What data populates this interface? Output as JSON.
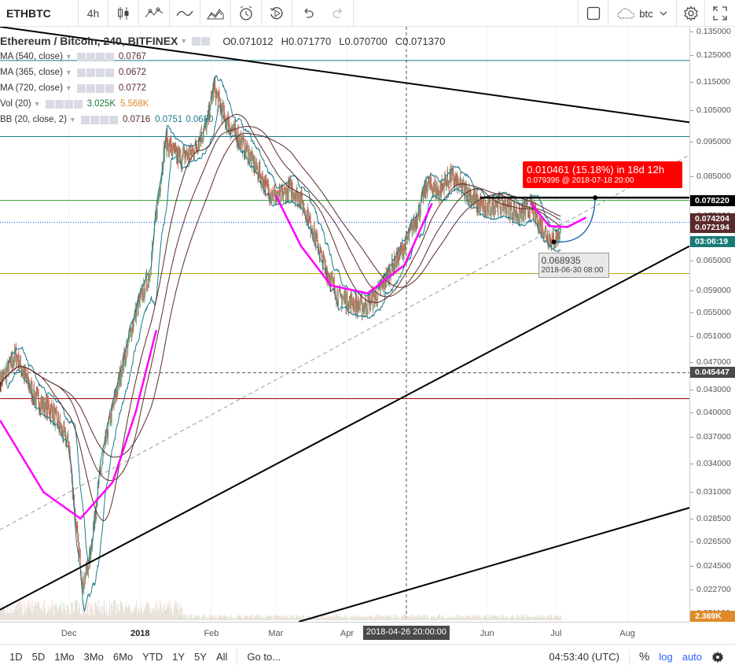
{
  "toolbar": {
    "symbol": "ETHBTC",
    "interval": "4h",
    "compare": "btc",
    "icons": [
      "candles-icon",
      "indicators-icon",
      "line-icon",
      "templates-icon",
      "alert-icon",
      "replay-icon",
      "undo-icon",
      "redo-icon",
      "fullscreen-box-icon",
      "cloud-icon",
      "settings-icon",
      "maximize-icon"
    ]
  },
  "legend": {
    "title": "Ethereum / Bitcoin, 240, BITFINEX",
    "ohlc": {
      "o": "O0.071012",
      "h": "H0.071770",
      "l": "L0.070700",
      "c": "C0.071370"
    },
    "studies": [
      {
        "label": "MA (540, close)",
        "value": "0.0767"
      },
      {
        "label": "MA (365, close)",
        "value": "0.0672"
      },
      {
        "label": "MA (720, close)",
        "value": "0.0772"
      },
      {
        "label": "Vol (20)",
        "value": "3.025K",
        "value2": "5.568K"
      },
      {
        "label": "BB (20, close, 2)",
        "value": "0.0716",
        "value2": "0.0751",
        "value3": "0.0680"
      }
    ]
  },
  "measure": {
    "main": "0.010461 (15.18%) in 18d 12h",
    "sub": "0.079396 @ 2018-07-18  20:00"
  },
  "low_label": {
    "price": "0.068935",
    "time": "2018-06-30 08:00"
  },
  "price_tags": {
    "level": "0.078220",
    "ma_a": "0.074204",
    "ma_b": "0.072194",
    "countdown": "03:06:19",
    "crosshair": "0.045447",
    "volume": "2.369K"
  },
  "time_axis": {
    "crosshair": "2018-04-26 20:00:00"
  },
  "bottombar": {
    "ranges": [
      "1D",
      "5D",
      "1Mo",
      "3Mo",
      "6Mo",
      "YTD",
      "1Y",
      "5Y",
      "All"
    ],
    "goto": "Go to...",
    "clock": "04:53:40 (UTC)",
    "percent": "%",
    "log": "log",
    "auto": "auto"
  },
  "colors": {
    "candle_up": "#6ba583",
    "candle_down": "#d75442",
    "bb": "#1b7a8a",
    "ma": "#5a2a2a",
    "magenta": "#ff00ff",
    "tag_red": "#ff0000",
    "tag_dark": "#5a2a2a",
    "tag_teal": "#1a7a78"
  },
  "chart_data": {
    "type": "candlestick",
    "symbol": "ETHBTC",
    "exchange": "BITFINEX",
    "interval": "240",
    "y_scale": "log",
    "ylim": [
      0.0205,
      0.137
    ],
    "xlim": [
      "2017-11-01",
      "2018-08-28"
    ],
    "y_ticks": [
      "0.135000",
      "0.125000",
      "0.115000",
      "0.105000",
      "0.095000",
      "0.085000",
      "0.075000",
      "0.065000",
      "0.059000",
      "0.055000",
      "0.051000",
      "0.047000",
      "0.043000",
      "0.040000",
      "0.037000",
      "0.034000",
      "0.031000",
      "0.028500",
      "0.026500",
      "0.024500",
      "0.022700",
      "0.021100"
    ],
    "x_ticks": [
      {
        "label": "Dec",
        "date": "2017-12-01"
      },
      {
        "label": "2018",
        "date": "2018-01-01",
        "bold": true
      },
      {
        "label": "Feb",
        "date": "2018-02-01"
      },
      {
        "label": "Mar",
        "date": "2018-03-01"
      },
      {
        "label": "Apr",
        "date": "2018-04-01"
      },
      {
        "label": "Jun",
        "date": "2018-06-01"
      },
      {
        "label": "Jul",
        "date": "2018-07-01"
      },
      {
        "label": "Aug",
        "date": "2018-08-01"
      }
    ],
    "price_path": [
      [
        "2017-11-01",
        0.044
      ],
      [
        "2017-11-08",
        0.048
      ],
      [
        "2017-11-16",
        0.042
      ],
      [
        "2017-11-24",
        0.04
      ],
      [
        "2017-12-01",
        0.036
      ],
      [
        "2017-12-04",
        0.028
      ],
      [
        "2017-12-07",
        0.023
      ],
      [
        "2017-12-10",
        0.025
      ],
      [
        "2017-12-14",
        0.032
      ],
      [
        "2017-12-18",
        0.038
      ],
      [
        "2017-12-24",
        0.046
      ],
      [
        "2017-12-30",
        0.055
      ],
      [
        "2018-01-05",
        0.062
      ],
      [
        "2018-01-09",
        0.08
      ],
      [
        "2018-01-12",
        0.095
      ],
      [
        "2018-01-18",
        0.09
      ],
      [
        "2018-01-24",
        0.092
      ],
      [
        "2018-01-30",
        0.1
      ],
      [
        "2018-02-02",
        0.113
      ],
      [
        "2018-02-07",
        0.102
      ],
      [
        "2018-02-14",
        0.095
      ],
      [
        "2018-02-20",
        0.088
      ],
      [
        "2018-02-25",
        0.082
      ],
      [
        "2018-03-02",
        0.079
      ],
      [
        "2018-03-07",
        0.082
      ],
      [
        "2018-03-12",
        0.079
      ],
      [
        "2018-03-17",
        0.072
      ],
      [
        "2018-03-22",
        0.064
      ],
      [
        "2018-03-28",
        0.058
      ],
      [
        "2018-04-02",
        0.057
      ],
      [
        "2018-04-08",
        0.056
      ],
      [
        "2018-04-14",
        0.058
      ],
      [
        "2018-04-20",
        0.063
      ],
      [
        "2018-04-26",
        0.068
      ],
      [
        "2018-05-01",
        0.074
      ],
      [
        "2018-05-06",
        0.083
      ],
      [
        "2018-05-11",
        0.081
      ],
      [
        "2018-05-16",
        0.085
      ],
      [
        "2018-05-21",
        0.082
      ],
      [
        "2018-05-26",
        0.079
      ],
      [
        "2018-05-31",
        0.076
      ],
      [
        "2018-06-05",
        0.078
      ],
      [
        "2018-06-10",
        0.077
      ],
      [
        "2018-06-15",
        0.075
      ],
      [
        "2018-06-20",
        0.077
      ],
      [
        "2018-06-25",
        0.072
      ],
      [
        "2018-06-30",
        0.0689
      ],
      [
        "2018-07-03",
        0.0714
      ]
    ],
    "horizontal_lines": [
      {
        "price": 0.123,
        "color": "#1b7a8a"
      },
      {
        "price": 0.0965,
        "color": "#1b7a8a"
      },
      {
        "price": 0.0787,
        "color": "#2e9d2e"
      },
      {
        "price": 0.0623,
        "color": "#a6a600"
      },
      {
        "price": 0.0418,
        "color": "#a00000"
      },
      {
        "price": 0.0734,
        "color": "#1f4fff",
        "dotted": true
      },
      {
        "price": 0.0454,
        "color": "#555555",
        "dashed": true
      }
    ],
    "trendlines": [
      {
        "from": [
          "2017-11-01",
          0.137
        ],
        "to": [
          "2018-08-28",
          0.101
        ],
        "color": "#000000",
        "width": 2
      },
      {
        "from": [
          "2017-11-01",
          0.0213
        ],
        "to": [
          "2018-08-28",
          0.068
        ],
        "color": "#000000",
        "width": 2
      },
      {
        "from": [
          "2018-03-11",
          0.0205
        ],
        "to": [
          "2018-08-28",
          0.0295
        ],
        "color": "#000000",
        "width": 2
      },
      {
        "from": [
          "2017-11-01",
          0.0275
        ],
        "to": [
          "2018-08-28",
          0.091
        ],
        "color": "#999999",
        "width": 1,
        "dashed": true
      },
      {
        "from": [
          "2018-05-29",
          0.0794
        ],
        "to": [
          "2018-08-28",
          0.0794
        ],
        "color": "#000000",
        "width": 2.5
      }
    ],
    "crosshair": {
      "date": "2018-04-26 20:00:00",
      "price": 0.045447
    },
    "measurement": {
      "from": [
        "2018-06-30",
        0.068935
      ],
      "to": [
        "2018-07-18",
        0.079396
      ],
      "change": 0.010461,
      "percent": 15.18
    }
  }
}
